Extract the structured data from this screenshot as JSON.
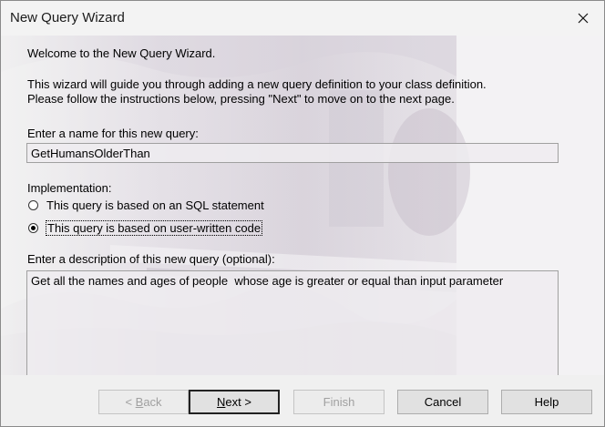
{
  "window": {
    "title": "New Query Wizard"
  },
  "intro": {
    "welcome": "Welcome to the New Query Wizard.",
    "line1": "This wizard will guide you through adding a new query definition to your class definition.",
    "line2": "Please follow the instructions below, pressing \"Next\" to move on to the next page."
  },
  "name_field": {
    "label": "Enter a name for this new query:",
    "value": "GetHumansOlderThan"
  },
  "implementation": {
    "label": "Implementation:",
    "options": [
      {
        "label": "This query is based on an SQL statement",
        "checked": false
      },
      {
        "label": "This query is based on user-written code",
        "checked": true
      }
    ]
  },
  "description": {
    "label": "Enter a description of this new query (optional):",
    "value": "Get all the names and ages of people  whose age is greater or equal than input parameter"
  },
  "buttons": {
    "back": {
      "mnemonic": "B",
      "rest": "ack",
      "prefix": "< ",
      "enabled": false
    },
    "next": {
      "mnemonic": "N",
      "rest": "ext >",
      "enabled": true
    },
    "finish": {
      "label": "Finish",
      "enabled": false
    },
    "cancel": {
      "label": "Cancel",
      "enabled": true
    },
    "help": {
      "label": "Help",
      "enabled": true
    }
  },
  "icons": {
    "close": "close-icon"
  }
}
